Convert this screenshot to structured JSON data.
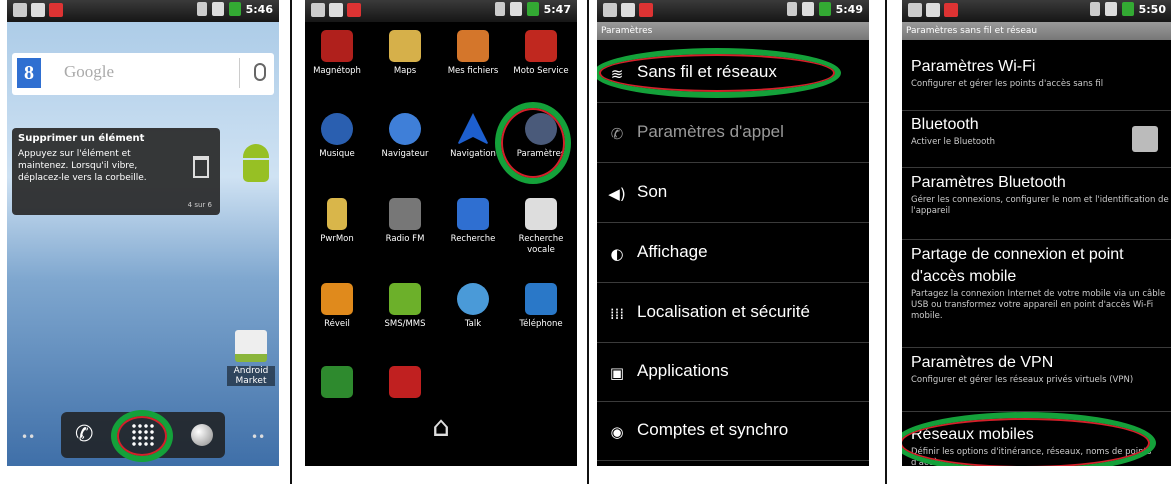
{
  "screens": {
    "home": {
      "status_time": "5:46",
      "search": {
        "placeholder": "Google"
      },
      "tooltip": {
        "title": "Supprimer un élément",
        "body": "Appuyez sur l'élément et maintenez. Lorsqu'il vibre, déplacez-le vers la corbeille.",
        "count": "4 sur 6"
      },
      "market_label": "Android Market"
    },
    "apps": {
      "status_time": "5:47",
      "items": [
        {
          "label": "Magnétoph",
          "color": "#b0201c"
        },
        {
          "label": "Maps",
          "color": "#d6b04a"
        },
        {
          "label": "Mes fichiers",
          "color": "#d4762b"
        },
        {
          "label": "Moto Service",
          "color": "#c0281f"
        },
        {
          "label": "Musique",
          "color": "#2a5fb0"
        },
        {
          "label": "Navigateur",
          "color": "#3f7fd8"
        },
        {
          "label": "Navigation",
          "color": "#1d5fcf"
        },
        {
          "label": "Paramètres",
          "color": "#4a5a7a"
        },
        {
          "label": "PwrMon",
          "color": "#d9b64a"
        },
        {
          "label": "Radio FM",
          "color": "#777777"
        },
        {
          "label": "Recherche",
          "color": "#2f6fd1"
        },
        {
          "label": "Recherche vocale",
          "color": "#dddddd"
        },
        {
          "label": "Réveil",
          "color": "#e08a1c"
        },
        {
          "label": "SMS/MMS",
          "color": "#6cb02a"
        },
        {
          "label": "Talk",
          "color": "#4a9ad8"
        },
        {
          "label": "Téléphone",
          "color": "#2a78c8"
        },
        {
          "label": "",
          "color": "#2e8a2e"
        },
        {
          "label": "",
          "color": "#c02020"
        }
      ]
    },
    "settings": {
      "status_time": "5:49",
      "title": "Paramètres",
      "items": [
        {
          "label": "Sans fil et réseaux",
          "icon": "wifi-icon"
        },
        {
          "label": "Paramètres d'appel",
          "icon": "phone-icon"
        },
        {
          "label": "Son",
          "icon": "speaker-icon"
        },
        {
          "label": "Affichage",
          "icon": "brightness-icon"
        },
        {
          "label": "Localisation et sécurité",
          "icon": "grid-icon"
        },
        {
          "label": "Applications",
          "icon": "image-icon"
        },
        {
          "label": "Comptes et synchro",
          "icon": "sync-icon"
        }
      ]
    },
    "wireless": {
      "status_time": "5:50",
      "title": "Paramètres sans fil et réseau",
      "items": [
        {
          "title": "Paramètres Wi-Fi",
          "sub": "Configurer et gérer les points d'accès sans fil"
        },
        {
          "title": "Bluetooth",
          "sub": "Activer le Bluetooth"
        },
        {
          "title": "Paramètres Bluetooth",
          "sub": "Gérer les connexions, configurer le nom et l'identification de l'appareil"
        },
        {
          "title": "Partage de connexion et point d'accès mobile",
          "sub": "Partagez la connexion Internet de votre mobile via un câble USB ou transformez votre appareil en point d'accès Wi-Fi mobile."
        },
        {
          "title": "Paramètres de VPN",
          "sub": "Configurer et gérer les réseaux privés virtuels (VPN)"
        },
        {
          "title": "Réseaux mobiles",
          "sub": "Définir les options d'itinérance, réseaux, noms de points d'accès"
        }
      ]
    }
  },
  "colors": {
    "highlight_green": "#14a13a",
    "highlight_red": "#d4202a"
  }
}
